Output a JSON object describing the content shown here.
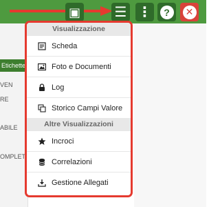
{
  "toolbar": {
    "buttons": [
      {
        "name": "save-button",
        "icon": "floppy-icon"
      },
      {
        "name": "menu-button",
        "icon": "hamburger-icon"
      },
      {
        "name": "more-button",
        "icon": "vertical-dots-icon"
      },
      {
        "name": "help-button",
        "label": "?"
      },
      {
        "name": "close-button",
        "label": "✕"
      }
    ],
    "colors": {
      "bar": "#4e9a3f",
      "button": "#2f6b2a",
      "close": "#d9423a",
      "annotation": "#e53a2f"
    }
  },
  "background": {
    "header_label": "Etichette",
    "fragments": [
      "VEN",
      "RE",
      "ABILE",
      "OMPLETA"
    ]
  },
  "dropdown": {
    "section1": "Visualizzazione",
    "items1": [
      {
        "label": "Scheda",
        "icon": "card-icon"
      },
      {
        "label": "Foto e Documenti",
        "icon": "image-icon"
      },
      {
        "label": "Log",
        "icon": "lock-icon"
      },
      {
        "label": "Storico Campi Valore",
        "icon": "copy-icon"
      }
    ],
    "section2": "Altre Visualizzazioni",
    "items2": [
      {
        "label": "Incroci",
        "icon": "star-icon"
      },
      {
        "label": "Correlazioni",
        "icon": "database-icon"
      },
      {
        "label": "Gestione Allegati",
        "icon": "download-icon"
      }
    ]
  }
}
